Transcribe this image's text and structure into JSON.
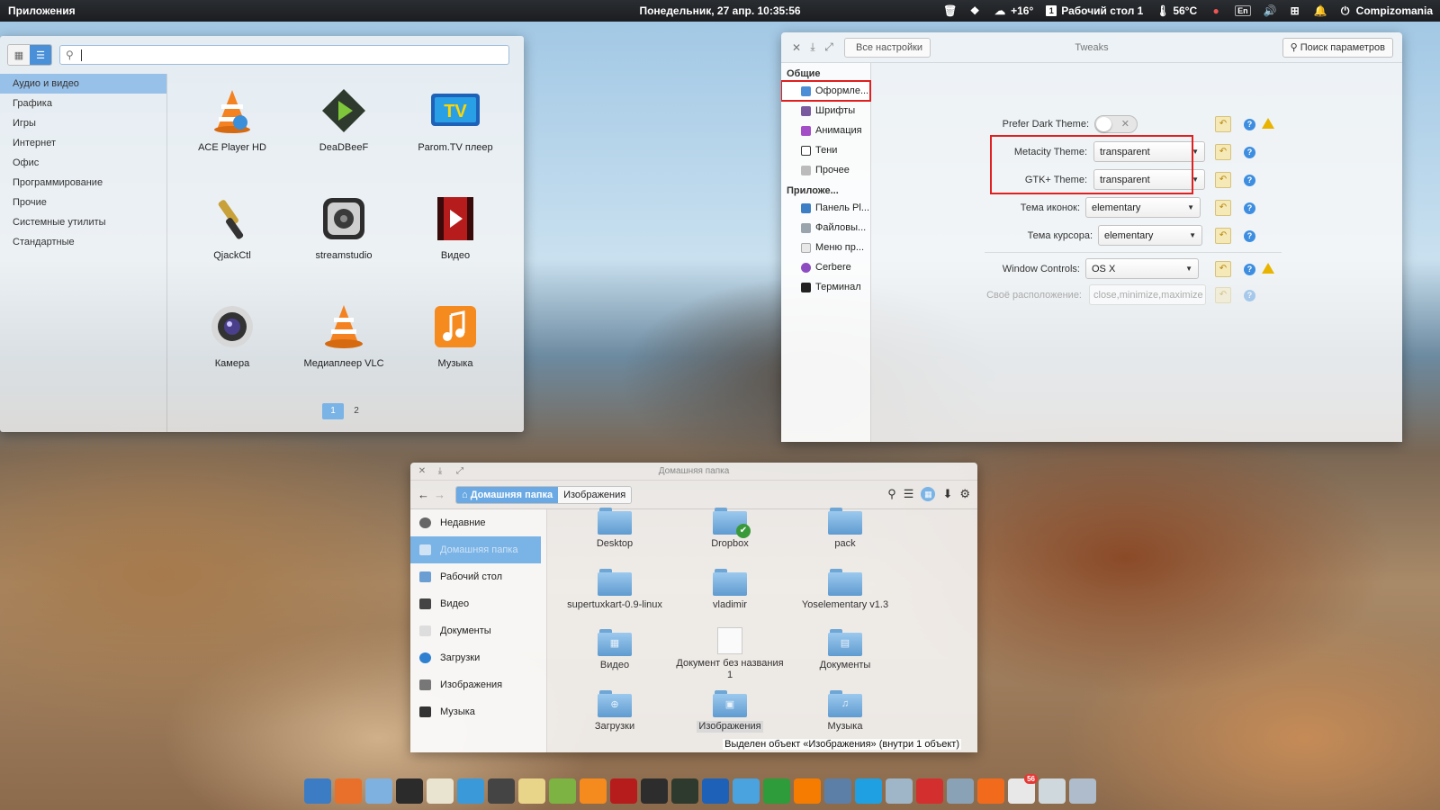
{
  "top_panel": {
    "applications": "Приложения",
    "clock": "Понедельник, 27 апр. 10:35:56",
    "weather": "+16°",
    "workspace": "Рабочий стол 1",
    "workspace_num": "1",
    "temperature": "56°C",
    "keyboard": "En",
    "user": "Compizomania"
  },
  "app_menu": {
    "search_value": "",
    "categories": [
      "Аудио и видео",
      "Графика",
      "Игры",
      "Интернет",
      "Офис",
      "Программирование",
      "Прочие",
      "Системные утилиты",
      "Стандартные"
    ],
    "apps": [
      {
        "label": "ACE Player HD",
        "icon": "ace-player-icon"
      },
      {
        "label": "DeaDBeeF",
        "icon": "deadbeef-icon"
      },
      {
        "label": "Parom.TV плеер",
        "icon": "parom-tv-icon"
      },
      {
        "label": "QjackCtl",
        "icon": "qjackctl-icon"
      },
      {
        "label": "streamstudio",
        "icon": "streamstudio-icon"
      },
      {
        "label": "Видео",
        "icon": "video-player-icon"
      },
      {
        "label": "Камера",
        "icon": "camera-icon"
      },
      {
        "label": "Медиаплеер VLC",
        "icon": "vlc-icon"
      },
      {
        "label": "Музыка",
        "icon": "music-icon"
      }
    ],
    "pages": [
      "1",
      "2"
    ]
  },
  "tweaks": {
    "title": "Tweaks",
    "back_label": "Все настройки",
    "search_label": "Поиск параметров",
    "section_general": "Общие",
    "general_items": [
      "Оформле...",
      "Шрифты",
      "Анимация",
      "Тени",
      "Прочее"
    ],
    "section_apps": "Приложе...",
    "app_items": [
      "Панель Pl...",
      "Файловы...",
      "Меню пр...",
      "Cerbere",
      "Терминал"
    ],
    "settings": {
      "dark_theme_label": "Prefer Dark Theme:",
      "metacity_label": "Metacity Theme:",
      "metacity_value": "transparent",
      "gtk_label": "GTK+ Theme:",
      "gtk_value": "transparent",
      "icons_label": "Тема иконок:",
      "icons_value": "elementary",
      "cursor_label": "Тема курсора:",
      "cursor_value": "elementary",
      "window_controls_label": "Window Controls:",
      "window_controls_value": "OS X",
      "custom_layout_label": "Своё расположение:",
      "custom_layout_value": "close,minimize,maximize"
    }
  },
  "files": {
    "title": "Домашняя папка",
    "crumbs": [
      "Домашняя папка",
      "Изображения"
    ],
    "places": [
      "Недавние",
      "Домашняя папка",
      "Рабочий стол",
      "Видео",
      "Документы",
      "Загрузки",
      "Изображения",
      "Музыка"
    ],
    "items": [
      {
        "label": "Desktop",
        "type": "folder",
        "emblem": ""
      },
      {
        "label": "Dropbox",
        "type": "folder",
        "emblem": "✔"
      },
      {
        "label": "pack",
        "type": "folder",
        "emblem": ""
      },
      {
        "label": "supertuxkart-0.9-linux",
        "type": "folder",
        "emblem": ""
      },
      {
        "label": "vladimir",
        "type": "folder",
        "emblem": ""
      },
      {
        "label": "Yoselementary v1.3",
        "type": "folder",
        "emblem": ""
      },
      {
        "label": "Видео",
        "type": "folder",
        "emblem": "▦"
      },
      {
        "label": "Документ без названия 1",
        "type": "doc",
        "emblem": ""
      },
      {
        "label": "Документы",
        "type": "folder",
        "emblem": "▤"
      },
      {
        "label": "Загрузки",
        "type": "folder",
        "emblem": "⊕"
      },
      {
        "label": "Изображения",
        "type": "folder",
        "emblem": "▣"
      },
      {
        "label": "Музыка",
        "type": "folder",
        "emblem": "♫"
      }
    ],
    "status": "Выделен объект «Изображения» (внутри 1 объект)"
  },
  "dock": {
    "badge": "56",
    "items": [
      "multitasking-icon",
      "firefox-icon",
      "files-icon",
      "terminal-icon",
      "text-editor-icon",
      "settings-icon",
      "screenshot-icon",
      "mail-icon",
      "calculator-icon",
      "music-icon",
      "video-icon",
      "streamstudio-icon",
      "deadbeef-icon",
      "parom-tv-icon",
      "photos-icon",
      "sync-icon",
      "software-center-icon",
      "toggle-icon",
      "skype-icon",
      "home-icon",
      "tasks-icon",
      "info-icon",
      "update-icon",
      "calendar-icon",
      "pen-icon",
      "trash-icon"
    ]
  },
  "colors": {
    "accent": "#4a90d9",
    "highlight_box": "#e02020",
    "warning": "#e8b400"
  }
}
